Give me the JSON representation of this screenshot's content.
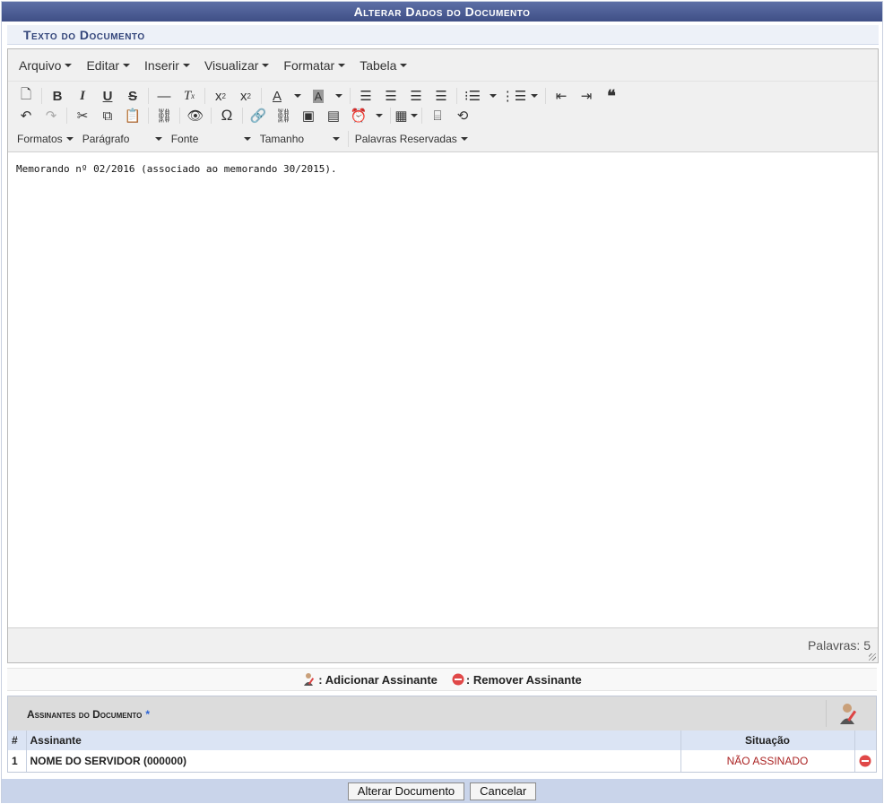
{
  "page": {
    "title": "Alterar Dados do Documento",
    "section_title": "Texto do Documento"
  },
  "editor": {
    "menus": [
      "Arquivo",
      "Editar",
      "Inserir",
      "Visualizar",
      "Formatar",
      "Tabela"
    ],
    "format_row": {
      "formats": "Formatos",
      "paragraph": "Parágrafo",
      "font": "Fonte",
      "size": "Tamanho",
      "reserved_words": "Palavras Reservadas"
    },
    "content": "Memorando nº 02/2016 (associado ao memorando 30/2015).",
    "word_count_label": "Palavras: 5"
  },
  "signers": {
    "legend_add": ": Adicionar Assinante",
    "legend_remove": ": Remover Assinante",
    "panel_title": "Assinantes do Documento",
    "required_mark": "*",
    "columns": {
      "number": "#",
      "signer": "Assinante",
      "status": "Situação"
    },
    "rows": [
      {
        "number": "1",
        "name": "NOME DO SERVIDOR (000000)",
        "status": "NÃO ASSINADO"
      }
    ]
  },
  "actions": {
    "submit": "Alterar Documento",
    "cancel": "Cancelar"
  },
  "colors": {
    "title_bar": "#3f4f86",
    "section_header_bg": "#edf1f8",
    "footer_bg": "#c9d4ea",
    "status_unsigned": "#a22222"
  },
  "icons": {
    "add_signer": "person-pen-icon",
    "remove_signer": "minus-circle-icon"
  }
}
